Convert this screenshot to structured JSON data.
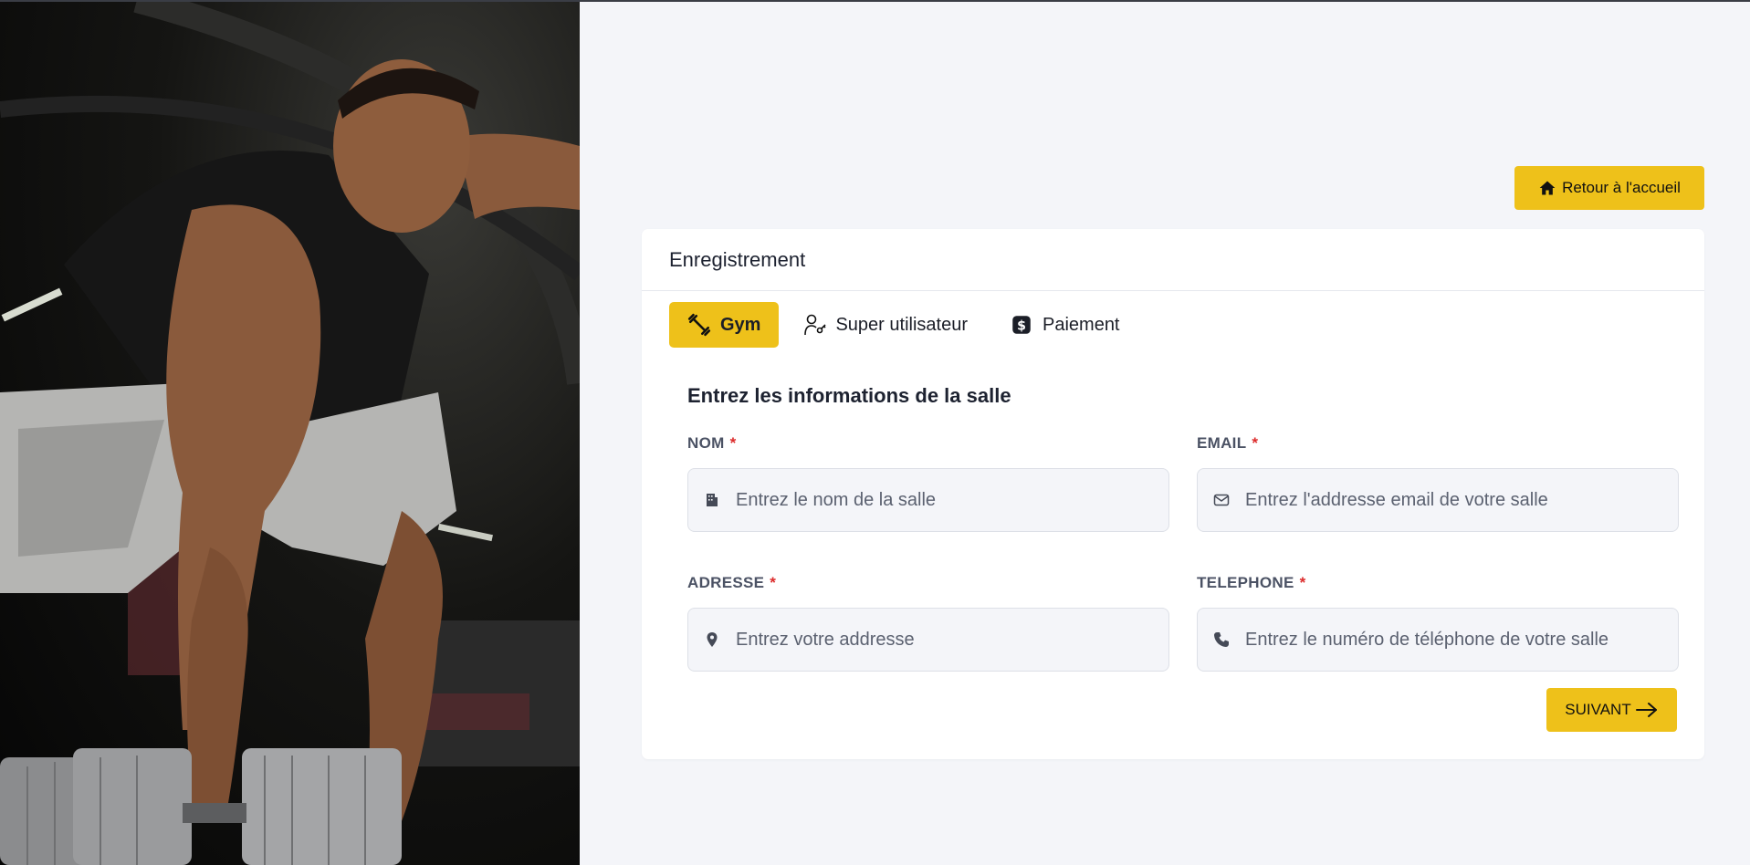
{
  "header": {
    "home_button_label": "Retour à l'accueil"
  },
  "card": {
    "title": "Enregistrement",
    "tabs": [
      {
        "label": "Gym",
        "icon": "dumbbell-icon",
        "active": true
      },
      {
        "label": "Super utilisateur",
        "icon": "user-key-icon",
        "active": false
      },
      {
        "label": "Paiement",
        "icon": "dollar-icon",
        "active": false
      }
    ],
    "section_title": "Entrez les informations de la salle",
    "fields": {
      "nom": {
        "label": "NOM",
        "required_mark": "*",
        "placeholder": "Entrez le nom de la salle",
        "icon": "building-icon",
        "value": ""
      },
      "email": {
        "label": "EMAIL",
        "required_mark": "*",
        "placeholder": "Entrez l'addresse email de votre salle",
        "icon": "envelope-icon",
        "value": ""
      },
      "adresse": {
        "label": "ADRESSE",
        "required_mark": "*",
        "placeholder": "Entrez votre addresse",
        "icon": "map-pin-icon",
        "value": ""
      },
      "telephone": {
        "label": "TELEPHONE",
        "required_mark": "*",
        "placeholder": "Entrez le numéro de téléphone de votre salle",
        "icon": "phone-icon",
        "value": ""
      }
    },
    "next_button_label": "SUIVANT"
  },
  "colors": {
    "accent": "#eec11a",
    "background": "#f4f5f9",
    "required": "#dc2b2b"
  }
}
